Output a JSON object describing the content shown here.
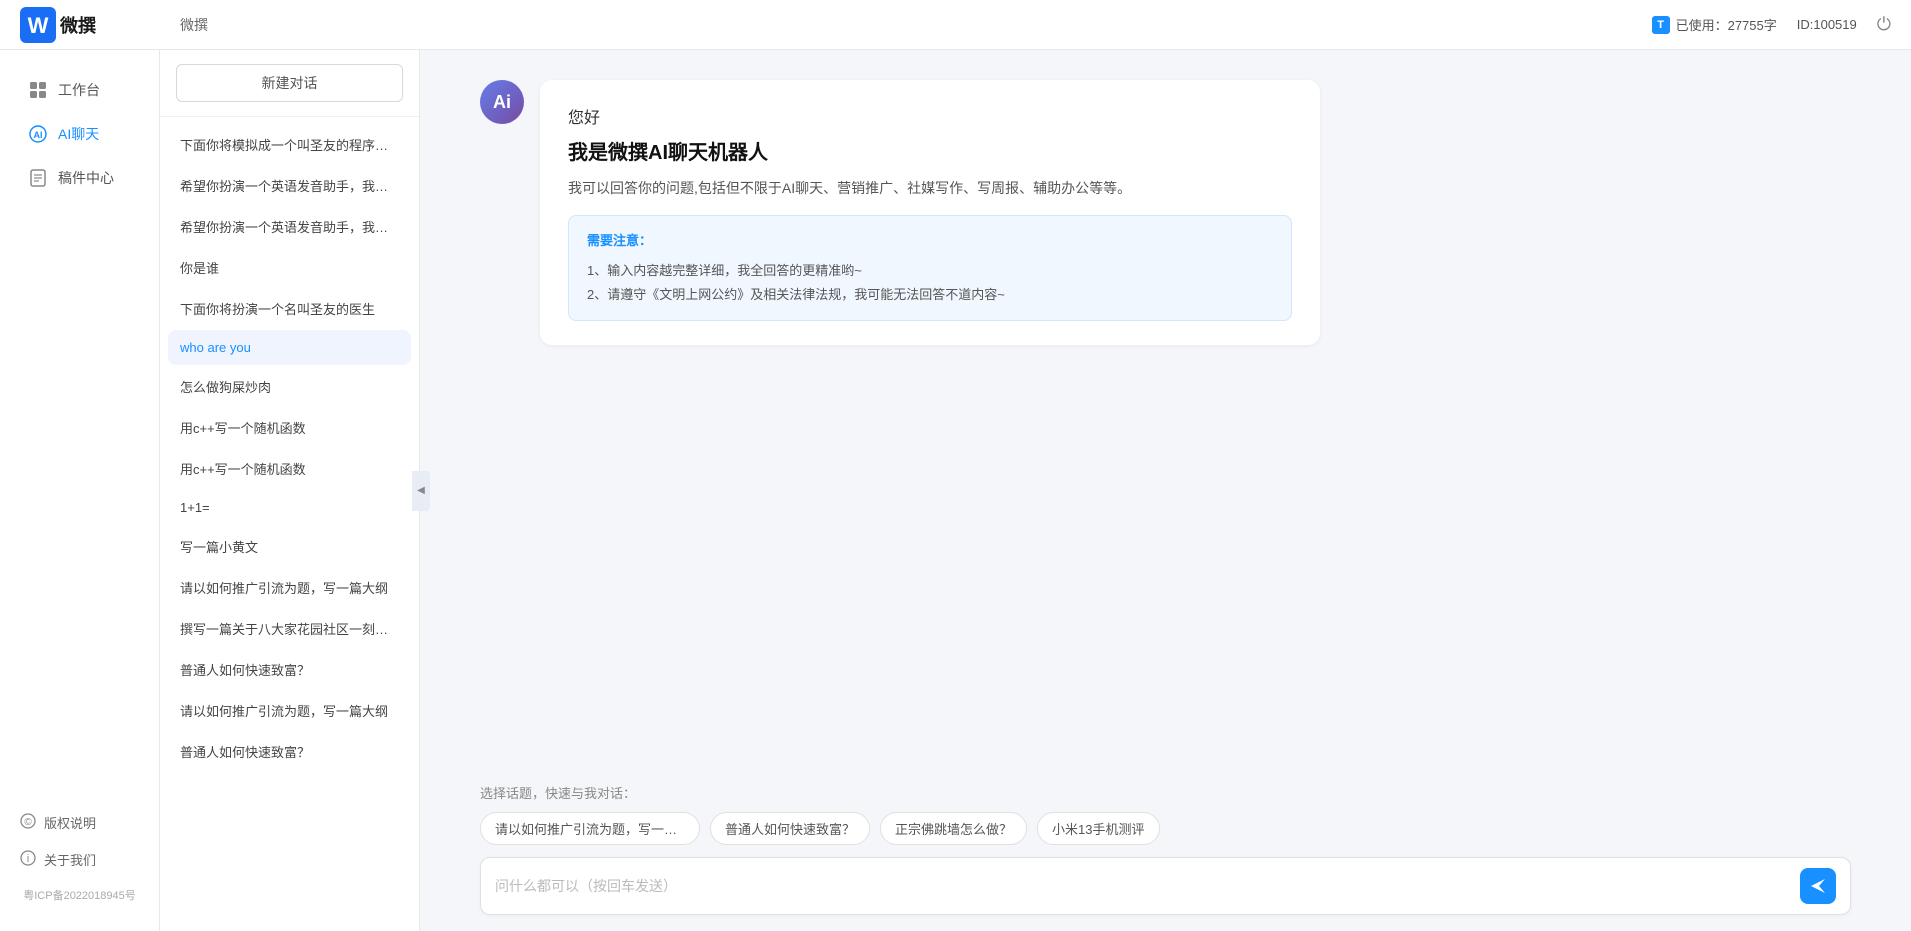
{
  "topbar": {
    "logo_text": "微撰",
    "page_title": "微撰",
    "usage_label": "已使用：27755字",
    "id_label": "ID:100519",
    "usage_icon": "T",
    "logout_icon": "⏻"
  },
  "sidebar": {
    "nav_items": [
      {
        "id": "workbench",
        "label": "工作台",
        "icon": "⊞"
      },
      {
        "id": "ai-chat",
        "label": "AI聊天",
        "icon": "💬",
        "active": true
      },
      {
        "id": "drafts",
        "label": "稿件中心",
        "icon": "📄"
      }
    ],
    "bottom_items": [
      {
        "id": "copyright",
        "label": "版权说明",
        "icon": "🛡"
      },
      {
        "id": "about",
        "label": "关于我们",
        "icon": "ℹ"
      }
    ],
    "icp": "粤ICP备2022018945号"
  },
  "conv_panel": {
    "new_btn_label": "新建对话",
    "conversations": [
      {
        "id": "c1",
        "text": "下面你将模拟成一个叫圣友的程序员，我说..."
      },
      {
        "id": "c2",
        "text": "希望你扮演一个英语发音助手，我提供给你..."
      },
      {
        "id": "c3",
        "text": "希望你扮演一个英语发音助手，我提供给你..."
      },
      {
        "id": "c4",
        "text": "你是谁"
      },
      {
        "id": "c5",
        "text": "下面你将扮演一个名叫圣友的医生"
      },
      {
        "id": "c6",
        "text": "who are you"
      },
      {
        "id": "c7",
        "text": "怎么做狗屎炒肉"
      },
      {
        "id": "c8",
        "text": "用c++写一个随机函数"
      },
      {
        "id": "c9",
        "text": "用c++写一个随机函数"
      },
      {
        "id": "c10",
        "text": "1+1="
      },
      {
        "id": "c11",
        "text": "写一篇小黄文"
      },
      {
        "id": "c12",
        "text": "请以如何推广引流为题，写一篇大纲"
      },
      {
        "id": "c13",
        "text": "撰写一篇关于八大家花园社区一刻钟便民生..."
      },
      {
        "id": "c14",
        "text": "普通人如何快速致富？"
      },
      {
        "id": "c15",
        "text": "请以如何推广引流为题，写一篇大纲"
      },
      {
        "id": "c16",
        "text": "普通人如何快速致富？"
      }
    ]
  },
  "chat": {
    "ai_avatar_letter": "Ai",
    "welcome_greeting": "您好",
    "welcome_title": "我是微撰AI聊天机器人",
    "welcome_desc": "我可以回答你的问题,包括但不限于AI聊天、营销推广、社媒写作、写周报、辅助办公等等。",
    "notice_title": "需要注意：",
    "notice_items": [
      "1、输入内容越完整详细，我全回答的更精准哟~",
      "2、请遵守《文明上网公约》及相关法律法规，我可能无法回答不道内容~"
    ],
    "quick_prompts_label": "选择话题，快速与我对话：",
    "quick_prompts": [
      "请以如何推广引流为题，写一篇...",
      "普通人如何快速致富？",
      "正宗佛跳墙怎么做？",
      "小米13手机测评"
    ],
    "input_placeholder": "问什么都可以（按回车发送）"
  }
}
